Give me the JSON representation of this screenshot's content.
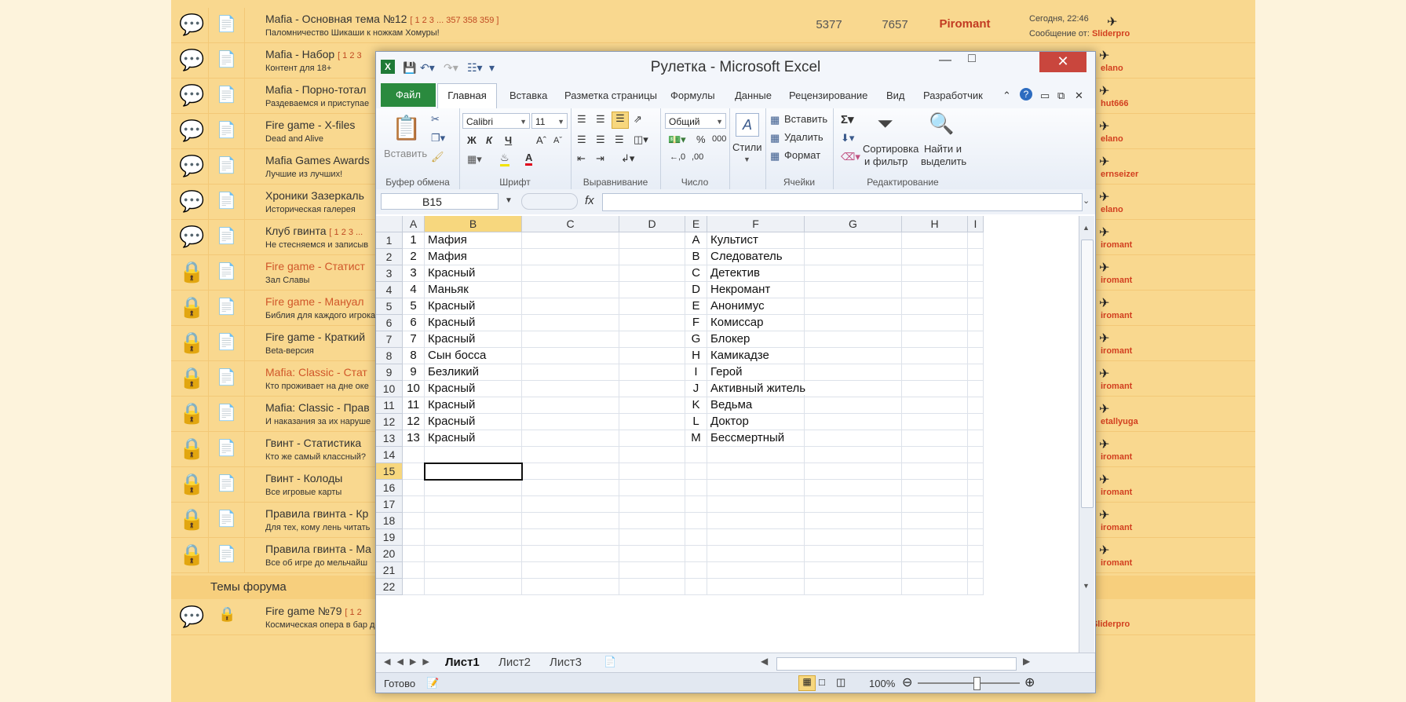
{
  "forum": {
    "rows": [
      {
        "title": "Mafia - Основная тема №12",
        "pages": "[ 1 2 3 ... 357 358 359 ]",
        "desc": "Паломничество Шикаши к ножкам Хомуры!",
        "replies": "5377",
        "views": "7657",
        "author": "Piromant",
        "last_time": "Сегодня, 22:46",
        "last_by_label": "Сообщение от:",
        "last_by": "Sliderpro",
        "red": false,
        "locked": false,
        "hot": true
      },
      {
        "title": "Mafia - Набор",
        "pages": "[ 1 2 3",
        "desc": "Контент для 18+",
        "right_user": "elano",
        "red": false,
        "locked": false
      },
      {
        "title": "Mafia - Порно-тотал",
        "pages": "",
        "desc": "Раздеваемся и приступае",
        "right_user": "hut666",
        "red": false,
        "locked": false
      },
      {
        "title": "Fire game - X-files",
        "pages": "",
        "desc": "Dead and Alive",
        "right_user": "elano",
        "red": false,
        "locked": false
      },
      {
        "title": "Mafia Games Awards",
        "pages": "",
        "desc": "Лучшие из лучших!",
        "right_user": "ernseizer",
        "red": false,
        "locked": false
      },
      {
        "title": "Хроники Зазеркаль",
        "pages": "",
        "desc": "Историческая галерея",
        "right_user": "elano",
        "red": false,
        "locked": false
      },
      {
        "title": "Клуб гвинта",
        "pages": "[ 1 2 3 ...",
        "desc": "Не стесняемся и записыв",
        "right_user": "iromant",
        "red": false,
        "locked": false
      },
      {
        "title": "Fire game - Статист",
        "pages": "",
        "desc": "Зал Славы",
        "right_user": "iromant",
        "red": true,
        "locked": true
      },
      {
        "title": "Fire game - Мануал",
        "pages": "",
        "desc": "Библия для каждого игрока",
        "right_user": "iromant",
        "red": true,
        "locked": true
      },
      {
        "title": "Fire game - Краткий",
        "pages": "",
        "desc": "Beta-версия",
        "right_user": "iromant",
        "red": false,
        "locked": true
      },
      {
        "title": "Mafia: Classic - Стат",
        "pages": "",
        "desc": "Кто проживает на дне оке",
        "right_user": "iromant",
        "red": true,
        "locked": true
      },
      {
        "title": "Mafia: Classic - Прав",
        "pages": "",
        "desc": "И наказания за их наруше",
        "right_user": "etallyuga",
        "red": false,
        "locked": true
      },
      {
        "title": "Гвинт - Статистика",
        "pages": "",
        "desc": "Кто же самый классный?",
        "right_user": "iromant",
        "red": false,
        "locked": true
      },
      {
        "title": "Гвинт - Колоды",
        "pages": "",
        "desc": "Все игровые карты",
        "right_user": "iromant",
        "red": false,
        "locked": true
      },
      {
        "title": "Правила гвинта - Кр",
        "pages": "",
        "desc": "Для тех, кому лень читать",
        "right_user": "iromant",
        "red": false,
        "locked": true
      },
      {
        "title": "Правила гвинта - Ма",
        "pages": "",
        "desc": "Все об игре до мельчайш",
        "right_user": "iromant",
        "red": false,
        "locked": true
      }
    ],
    "section_title": "Темы форума",
    "last_row": {
      "title": "Fire game №79",
      "pages": "[ 1 2",
      "desc": "Космическая опера в бар дол",
      "last_by_label": "Сообщение от:",
      "last_by": "Sliderpro"
    }
  },
  "excel": {
    "title": "Рулетка  -  Microsoft Excel",
    "tabs": [
      "Файл",
      "Главная",
      "Вставка",
      "Разметка страницы",
      "Формулы",
      "Данные",
      "Рецензирование",
      "Вид",
      "Разработчик"
    ],
    "ribbon": {
      "clipboard": {
        "label": "Буфер обмена",
        "paste": "Вставить"
      },
      "font": {
        "label": "Шрифт",
        "font_name": "Calibri",
        "font_size": "11",
        "bold": "Ж",
        "italic": "К",
        "underline": "Ч"
      },
      "alignment": {
        "label": "Выравнивание"
      },
      "number": {
        "label": "Число",
        "format": "Общий",
        "percent": "%",
        "thousands": "000"
      },
      "styles": {
        "label": "Стили"
      },
      "cells": {
        "label": "Ячейки",
        "insert": "Вставить",
        "delete": "Удалить",
        "format": "Формат"
      },
      "editing": {
        "label": "Редактирование",
        "sort1": "Сортировка",
        "sort2": "и фильтр",
        "find1": "Найти и",
        "find2": "выделить"
      }
    },
    "name_box": "B15",
    "formula": "",
    "columns": [
      "A",
      "B",
      "C",
      "D",
      "E",
      "F",
      "G",
      "H",
      "I"
    ],
    "rows": [
      {
        "n": "1",
        "a": "1",
        "b": "Мафия",
        "e": "A",
        "f": "Культист"
      },
      {
        "n": "2",
        "a": "2",
        "b": "Мафия",
        "e": "B",
        "f": "Следователь"
      },
      {
        "n": "3",
        "a": "3",
        "b": "Красный",
        "e": "C",
        "f": "Детектив"
      },
      {
        "n": "4",
        "a": "4",
        "b": "Маньяк",
        "e": "D",
        "f": "Некромант"
      },
      {
        "n": "5",
        "a": "5",
        "b": "Красный",
        "e": "E",
        "f": "Анонимус"
      },
      {
        "n": "6",
        "a": "6",
        "b": "Красный",
        "e": "F",
        "f": "Комиссар"
      },
      {
        "n": "7",
        "a": "7",
        "b": "Красный",
        "e": "G",
        "f": "Блокер"
      },
      {
        "n": "8",
        "a": "8",
        "b": "Сын босса",
        "e": "H",
        "f": "Камикадзе"
      },
      {
        "n": "9",
        "a": "9",
        "b": "Безликий",
        "e": "I",
        "f": "Герой"
      },
      {
        "n": "10",
        "a": "10",
        "b": "Красный",
        "e": "J",
        "f": "Активный житель"
      },
      {
        "n": "11",
        "a": "11",
        "b": "Красный",
        "e": "K",
        "f": "Ведьма"
      },
      {
        "n": "12",
        "a": "12",
        "b": "Красный",
        "e": "L",
        "f": "Доктор"
      },
      {
        "n": "13",
        "a": "13",
        "b": "Красный",
        "e": "M",
        "f": "Бессмертный"
      },
      {
        "n": "14"
      },
      {
        "n": "15"
      },
      {
        "n": "16"
      },
      {
        "n": "17"
      },
      {
        "n": "18"
      },
      {
        "n": "19"
      },
      {
        "n": "20"
      },
      {
        "n": "21"
      },
      {
        "n": "22"
      }
    ],
    "sheets": [
      "Лист1",
      "Лист2",
      "Лист3"
    ],
    "status": "Готово",
    "zoom": "100%",
    "colors": {
      "accent_green": "#2a8a3e",
      "selection": "#f7d77e",
      "close": "#c9463d"
    }
  }
}
